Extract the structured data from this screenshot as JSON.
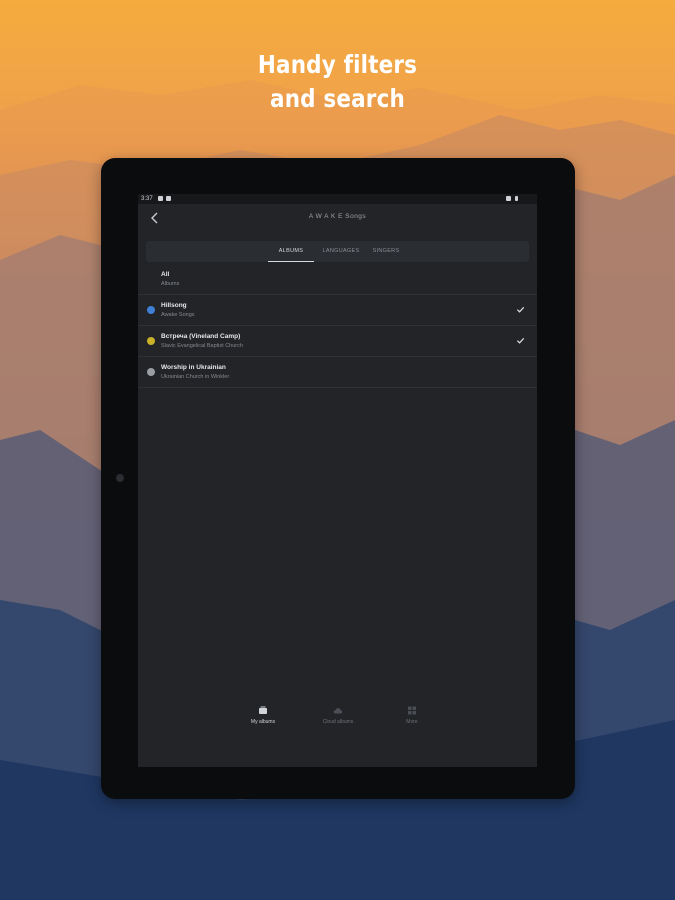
{
  "headline": {
    "line1": "Handy filters",
    "line2": "and search"
  },
  "status_bar": {
    "time": "3:37"
  },
  "app_bar": {
    "title": "A W A K E Songs",
    "back_icon": "back-arrow-icon"
  },
  "tabs": [
    {
      "label": "ALBUMS",
      "active": true
    },
    {
      "label": "LANGUAGES",
      "active": false
    },
    {
      "label": "SINGERS",
      "active": false
    }
  ],
  "albums": [
    {
      "title": "All",
      "subtitle": "Albums",
      "avatar": "none",
      "checked": false
    },
    {
      "title": "Hillsong",
      "subtitle": "Awake Songs",
      "avatar": "hillsong-logo-icon",
      "avatar_color": "#3f7fd6",
      "checked": true
    },
    {
      "title": "Встреча (Vineland Camp)",
      "subtitle": "Slavic Evangelical Baptist Church",
      "avatar": "vineland-logo-icon",
      "avatar_color": "#c9b12a",
      "checked": true
    },
    {
      "title": "Worship in Ukrainian",
      "subtitle": "Ukrainian Church in Winkler",
      "avatar": "church-logo-icon",
      "avatar_color": "#9a9ea3",
      "checked": false
    }
  ],
  "bottom_nav": [
    {
      "label": "My albums",
      "icon": "album-icon",
      "active": true
    },
    {
      "label": "Cloud albums",
      "icon": "cloud-icon",
      "active": false
    },
    {
      "label": "More",
      "icon": "grid-icon",
      "active": false
    }
  ],
  "colors": {
    "accent": "#d8dadd",
    "screen_bg": "#222427",
    "sky_top": "#f6ab3d",
    "sky_bottom": "#1e3a66"
  }
}
